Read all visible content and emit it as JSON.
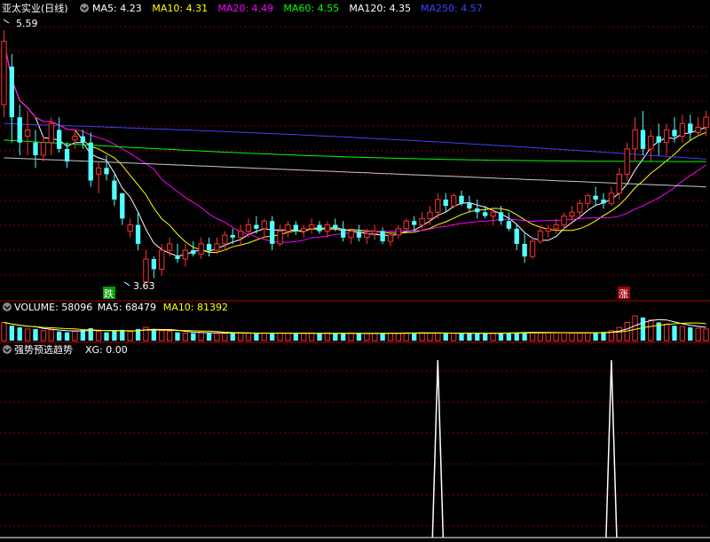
{
  "header": {
    "stock": "亚太实业(日线)",
    "ma": [
      {
        "label": "MA5: 4.23",
        "color": "#ffffff"
      },
      {
        "label": "MA10: 4.31",
        "color": "#ffff00"
      },
      {
        "label": "MA20: 4.49",
        "color": "#ff00ff"
      },
      {
        "label": "MA60: 4.55",
        "color": "#00ff00"
      },
      {
        "label": "MA120: 4.35",
        "color": "#ffffff"
      },
      {
        "label": "MA250: 4.57",
        "color": "#4040ff"
      }
    ]
  },
  "price_panel": {
    "high_label": "5.59",
    "low_label": "3.63",
    "fall_mark": "跌",
    "rise_mark": "涨"
  },
  "volume_panel": {
    "labels": [
      {
        "label": "VOLUME: 58096",
        "color": "#ffffff"
      },
      {
        "label": "MA5: 68479",
        "color": "#ffffff"
      },
      {
        "label": "MA10: 81392",
        "color": "#ffff00"
      }
    ]
  },
  "indicator_panel": {
    "title": "强势预选趋势",
    "value_label": "XG: 0.00"
  },
  "colors": {
    "up": "#ff3232",
    "down": "#54ffff",
    "grid": "#800000",
    "ma5": "#ffffff",
    "ma10": "#ffff00",
    "ma20": "#ff00ff",
    "ma60": "#00ff00",
    "ma120": "#c8c8c8",
    "ma250": "#4040ff"
  },
  "chart_data": {
    "type": "candlestick",
    "y_range_price": [
      3.5,
      5.7
    ],
    "ohlc": [
      [
        5.0,
        5.59,
        4.9,
        5.5
      ],
      [
        5.3,
        5.4,
        4.7,
        4.9
      ],
      [
        4.9,
        5.0,
        4.6,
        4.7
      ],
      [
        4.75,
        4.95,
        4.6,
        4.8
      ],
      [
        4.7,
        4.8,
        4.5,
        4.6
      ],
      [
        4.6,
        4.75,
        4.55,
        4.7
      ],
      [
        4.7,
        4.9,
        4.6,
        4.85
      ],
      [
        4.8,
        4.9,
        4.62,
        4.65
      ],
      [
        4.65,
        4.7,
        4.5,
        4.55
      ],
      [
        4.72,
        4.8,
        4.65,
        4.75
      ],
      [
        4.75,
        4.8,
        4.65,
        4.7
      ],
      [
        4.7,
        4.78,
        4.35,
        4.4
      ],
      [
        4.45,
        4.55,
        4.3,
        4.5
      ],
      [
        4.5,
        4.6,
        4.4,
        4.45
      ],
      [
        4.4,
        4.45,
        4.2,
        4.25
      ],
      [
        4.3,
        4.3,
        4.05,
        4.1
      ],
      [
        4.0,
        4.1,
        3.95,
        4.05
      ],
      [
        4.05,
        4.15,
        3.85,
        3.9
      ],
      [
        3.6,
        3.65,
        3.85,
        3.78
      ],
      [
        3.78,
        3.8,
        3.63,
        3.7
      ],
      [
        3.7,
        3.9,
        3.65,
        3.85
      ],
      [
        3.85,
        3.95,
        3.8,
        3.9
      ],
      [
        3.8,
        3.9,
        3.75,
        3.78
      ],
      [
        3.78,
        3.9,
        3.72,
        3.85
      ],
      [
        3.85,
        3.92,
        3.8,
        3.82
      ],
      [
        3.82,
        3.95,
        3.78,
        3.9
      ],
      [
        3.9,
        3.95,
        3.8,
        3.85
      ],
      [
        3.85,
        3.95,
        3.82,
        3.9
      ],
      [
        3.9,
        4.0,
        3.85,
        3.97
      ],
      [
        3.97,
        4.02,
        3.9,
        3.95
      ],
      [
        3.95,
        4.05,
        3.9,
        4.0
      ],
      [
        4.0,
        4.1,
        3.95,
        4.05
      ],
      [
        4.05,
        4.12,
        3.98,
        4.02
      ],
      [
        4.02,
        4.1,
        3.95,
        4.08
      ],
      [
        4.08,
        4.12,
        3.85,
        3.9
      ],
      [
        3.9,
        4.05,
        3.88,
        4.0
      ],
      [
        4.0,
        4.08,
        3.95,
        4.05
      ],
      [
        4.05,
        4.08,
        3.97,
        4.0
      ],
      [
        4.0,
        4.05,
        3.95,
        4.02
      ],
      [
        4.02,
        4.1,
        3.98,
        4.05
      ],
      [
        4.05,
        4.08,
        3.98,
        4.0
      ],
      [
        4.0,
        4.08,
        3.95,
        4.05
      ],
      [
        4.05,
        4.1,
        4.0,
        4.02
      ],
      [
        4.02,
        4.08,
        3.92,
        3.95
      ],
      [
        3.95,
        4.02,
        3.9,
        4.0
      ],
      [
        4.0,
        4.05,
        3.92,
        3.95
      ],
      [
        3.95,
        4.02,
        3.9,
        3.98
      ],
      [
        3.98,
        4.05,
        3.93,
        4.0
      ],
      [
        4.0,
        4.03,
        3.9,
        3.92
      ],
      [
        3.92,
        4.0,
        3.88,
        3.97
      ],
      [
        3.97,
        4.05,
        3.94,
        4.02
      ],
      [
        4.02,
        4.1,
        4.0,
        4.08
      ],
      [
        4.08,
        4.12,
        4.0,
        4.05
      ],
      [
        4.05,
        4.15,
        4.02,
        4.1
      ],
      [
        4.1,
        4.2,
        4.05,
        4.15
      ],
      [
        4.15,
        4.3,
        4.1,
        4.25
      ],
      [
        4.25,
        4.3,
        4.15,
        4.2
      ],
      [
        4.2,
        4.3,
        4.18,
        4.28
      ],
      [
        4.28,
        4.32,
        4.2,
        4.22
      ],
      [
        4.22,
        4.28,
        4.15,
        4.18
      ],
      [
        4.18,
        4.25,
        4.1,
        4.15
      ],
      [
        4.15,
        4.2,
        4.1,
        4.12
      ],
      [
        4.12,
        4.18,
        4.05,
        4.15
      ],
      [
        4.15,
        4.2,
        4.05,
        4.08
      ],
      [
        4.08,
        4.15,
        4.0,
        4.02
      ],
      [
        4.02,
        4.05,
        3.85,
        3.9
      ],
      [
        3.9,
        3.98,
        3.75,
        3.8
      ],
      [
        3.8,
        3.95,
        3.78,
        3.92
      ],
      [
        3.92,
        4.05,
        3.9,
        4.0
      ],
      [
        4.0,
        4.05,
        3.95,
        4.02
      ],
      [
        4.02,
        4.1,
        3.98,
        4.05
      ],
      [
        4.05,
        4.15,
        4.02,
        4.12
      ],
      [
        4.12,
        4.2,
        4.08,
        4.15
      ],
      [
        4.15,
        4.25,
        4.1,
        4.22
      ],
      [
        4.22,
        4.3,
        4.18,
        4.28
      ],
      [
        4.28,
        4.35,
        4.2,
        4.25
      ],
      [
        4.25,
        4.3,
        4.18,
        4.22
      ],
      [
        4.22,
        4.35,
        4.2,
        4.3
      ],
      [
        4.3,
        4.5,
        4.25,
        4.45
      ],
      [
        4.45,
        4.7,
        4.4,
        4.65
      ],
      [
        4.65,
        4.9,
        4.55,
        4.8
      ],
      [
        4.8,
        4.95,
        4.6,
        4.65
      ],
      [
        4.65,
        4.8,
        4.55,
        4.75
      ],
      [
        4.75,
        4.85,
        4.6,
        4.7
      ],
      [
        4.7,
        4.85,
        4.6,
        4.8
      ],
      [
        4.8,
        4.9,
        4.7,
        4.75
      ],
      [
        4.75,
        4.92,
        4.7,
        4.85
      ],
      [
        4.85,
        4.92,
        4.72,
        4.78
      ],
      [
        4.78,
        4.9,
        4.75,
        4.82
      ],
      [
        4.82,
        4.95,
        4.75,
        4.9
      ]
    ],
    "volume": [
      22000,
      18000,
      16000,
      14000,
      14000,
      12000,
      13000,
      11000,
      10000,
      12000,
      13000,
      15000,
      11000,
      10000,
      12000,
      13000,
      11000,
      14000,
      16000,
      14000,
      12000,
      11000,
      10000,
      9000,
      9000,
      10000,
      9500,
      9000,
      8800,
      9200,
      9400,
      9000,
      8700,
      8900,
      9100,
      9300,
      9000,
      8800,
      8600,
      8900,
      9100,
      9000,
      8700,
      8800,
      9000,
      8600,
      8500,
      8700,
      8900,
      9100,
      9200,
      9400,
      9600,
      9300,
      9100,
      9000,
      8900,
      8800,
      8700,
      8600,
      8800,
      9000,
      9200,
      9500,
      9700,
      9900,
      10200,
      10000,
      9800,
      9600,
      9400,
      9300,
      9200,
      9000,
      9500,
      9800,
      10500,
      12000,
      16000,
      22000,
      30000,
      28000,
      25000,
      22000,
      20000,
      18000,
      17000,
      16000,
      15000,
      14000
    ],
    "xg_peaks": [
      55,
      77
    ]
  }
}
